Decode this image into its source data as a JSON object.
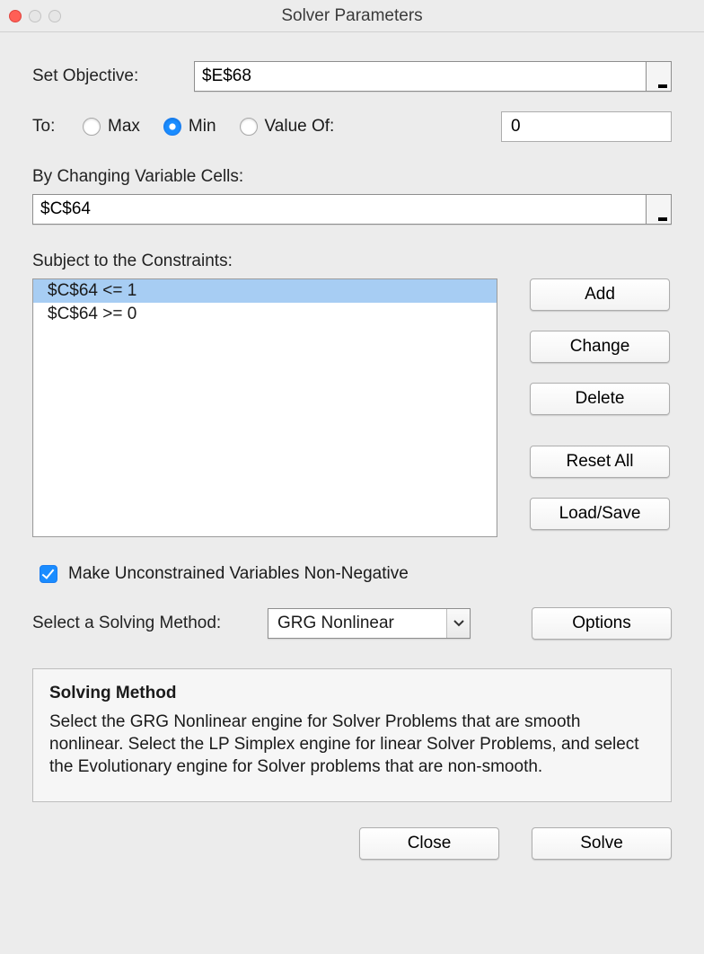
{
  "window": {
    "title": "Solver Parameters"
  },
  "objective": {
    "label": "Set Objective:",
    "value": "$E$68"
  },
  "to": {
    "label": "To:",
    "max_label": "Max",
    "min_label": "Min",
    "valueof_label": "Value Of:",
    "selected": "min",
    "valueof_value": "0"
  },
  "changing": {
    "label": "By Changing Variable Cells:",
    "value": "$C$64"
  },
  "constraints": {
    "label": "Subject to the Constraints:",
    "items": [
      {
        "text": "$C$64 <= 1",
        "selected": true
      },
      {
        "text": "$C$64 >= 0",
        "selected": false
      }
    ]
  },
  "side_buttons": {
    "add": "Add",
    "change": "Change",
    "delete": "Delete",
    "reset_all": "Reset All",
    "load_save": "Load/Save"
  },
  "nonneg": {
    "checked": true,
    "label": "Make Unconstrained Variables Non-Negative"
  },
  "method": {
    "label": "Select a Solving Method:",
    "selected": "GRG Nonlinear",
    "options_btn": "Options"
  },
  "help": {
    "title": "Solving Method",
    "body": "Select the GRG Nonlinear engine for Solver Problems that are smooth nonlinear. Select the LP Simplex engine for linear Solver Problems, and select the Evolutionary engine for Solver problems that are non-smooth."
  },
  "footer": {
    "close": "Close",
    "solve": "Solve"
  }
}
